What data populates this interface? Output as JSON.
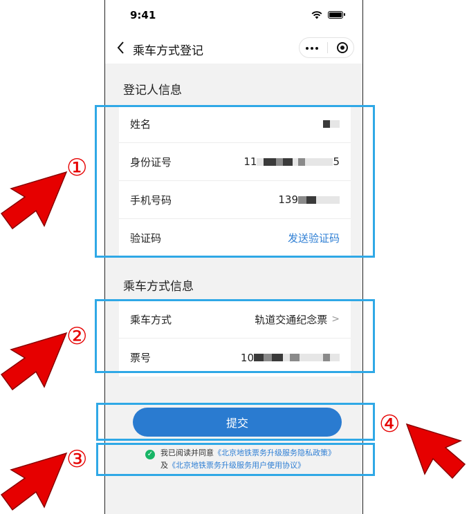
{
  "status_bar": {
    "time": "9:41"
  },
  "nav": {
    "title": "乘车方式登记"
  },
  "registrant": {
    "title": "登记人信息",
    "name_label": "姓名",
    "id_label": "身份证号",
    "id_prefix": "11",
    "id_suffix": "5",
    "phone_label": "手机号码",
    "phone_prefix": "139",
    "code_label": "验证码",
    "send_code": "发送验证码"
  },
  "ride": {
    "title": "乘车方式信息",
    "method_label": "乘车方式",
    "method_value": "轨道交通纪念票",
    "ticket_label": "票号",
    "ticket_prefix": "10"
  },
  "submit_label": "提交",
  "agreement": {
    "prefix": "我已阅读并同意",
    "privacy_policy": "《北京地铁票务升级服务隐私政策》",
    "joiner": "及",
    "user_agreement": "《北京地铁票务升级服务用户使用协议》"
  },
  "annotations": {
    "n1": "①",
    "n2": "②",
    "n3": "③",
    "n4": "④"
  },
  "colors": {
    "accent": "#2a7bd0",
    "highlight": "#2fa8e6",
    "annotation": "#e60000",
    "check": "#18b566"
  }
}
